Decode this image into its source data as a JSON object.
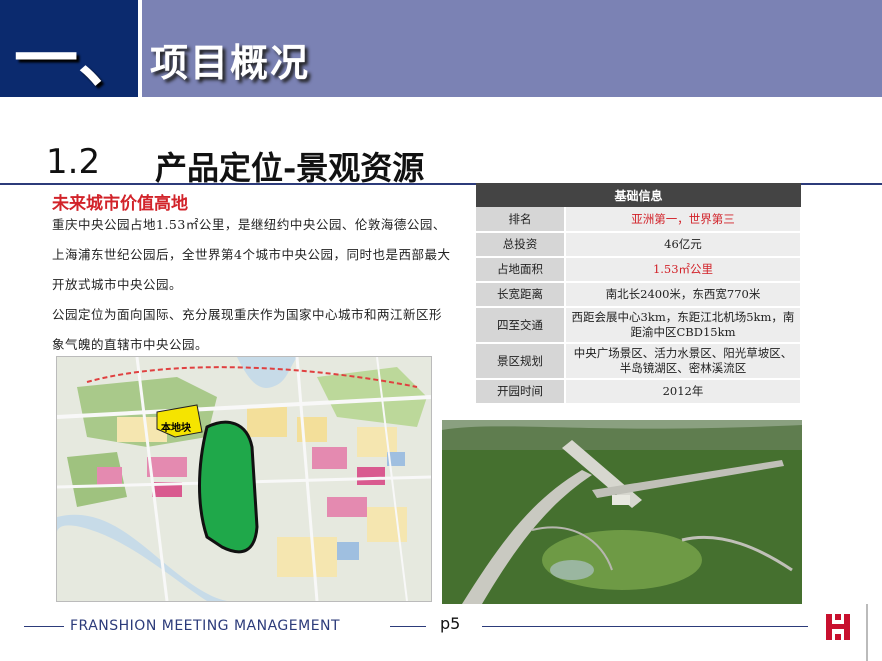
{
  "header": {
    "number": "一、",
    "title": "项目概况"
  },
  "section": {
    "number": "1.2",
    "title": "产品定位-景观资源"
  },
  "content": {
    "heading": "未来城市价值高地",
    "paragraph1": "重庆中央公园占地1.53㎡公里，是继纽约中央公园、伦敦海德公园、上海浦东世纪公园后，全世界第4个城市中央公园，同时也是西部最大开放式城市中央公园。",
    "paragraph2": "公园定位为面向国际、充分展现重庆作为国家中心城市和两江新区形象气魄的直辖市中央公园。"
  },
  "info_table": {
    "header": "基础信息",
    "rows": [
      {
        "key": "排名",
        "value": "亚洲第一，世界第三"
      },
      {
        "key": "总投资",
        "value": "46亿元"
      },
      {
        "key": "占地面积",
        "value": "1.53㎡公里"
      },
      {
        "key": "长宽距离",
        "value": "南北长2400米，东西宽770米"
      },
      {
        "key": "四至交通",
        "value": "西距会展中心3km，东距江北机场5km，南距渝中区CBD15km"
      },
      {
        "key": "景区规划",
        "value": "中央广场景区、活力水景区、阳光草坡区、半岛镜湖区、密林溪流区"
      },
      {
        "key": "开园时间",
        "value": "2012年"
      }
    ]
  },
  "map": {
    "label": "本地块"
  },
  "footer": {
    "text": "FRANSHION MEETING MANAGEMENT",
    "page": "p5"
  },
  "colors": {
    "header_dark": "#0b2a6e",
    "header_light": "#7b82b4",
    "accent_red": "#d2232a",
    "rule": "#2c3b7a"
  }
}
